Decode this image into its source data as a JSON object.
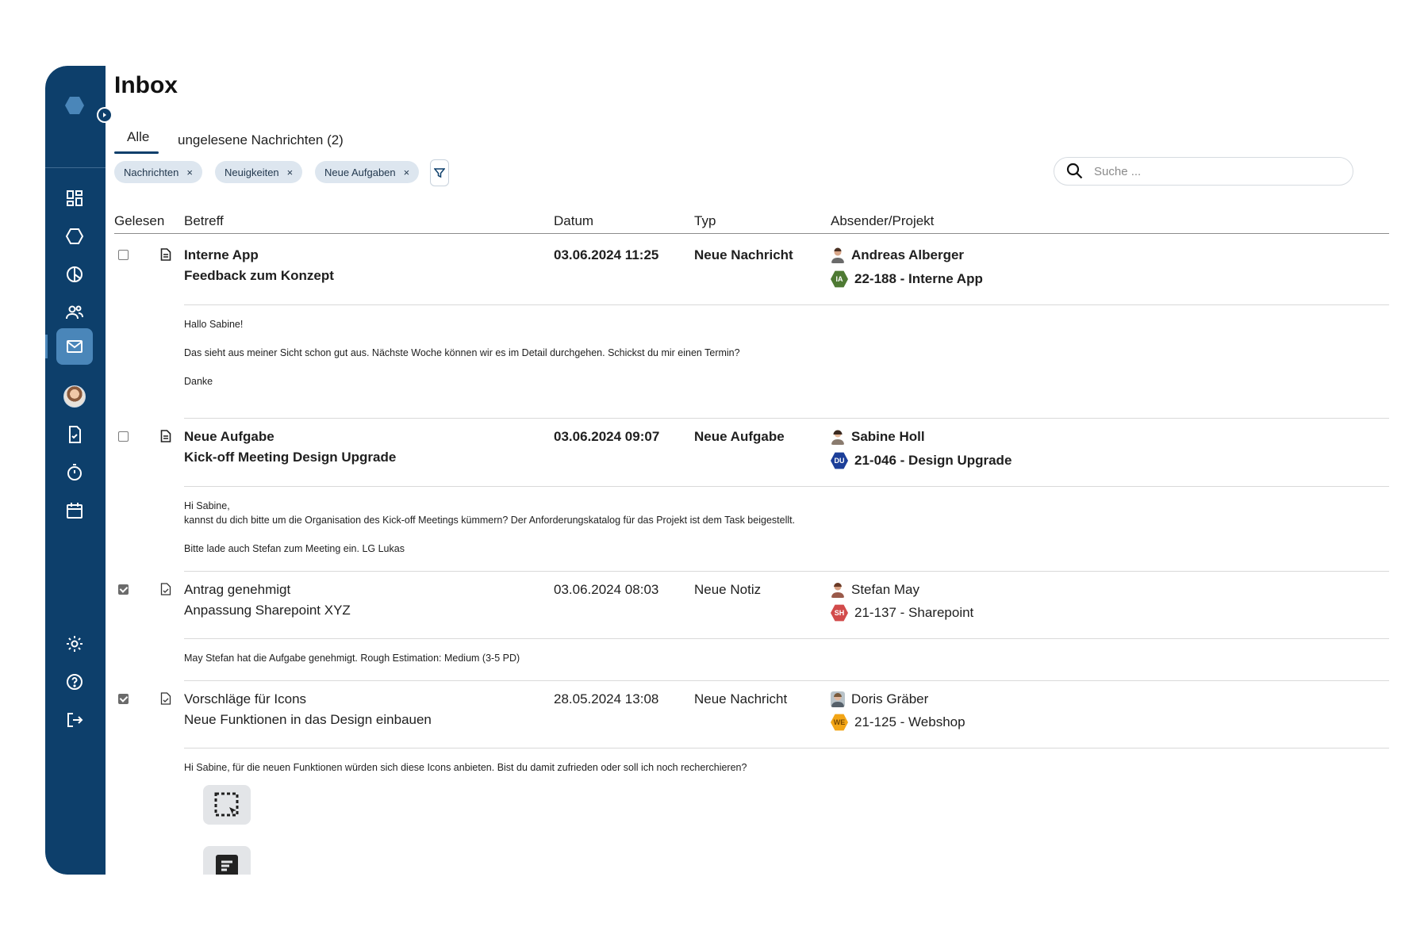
{
  "page": {
    "title": "Inbox"
  },
  "tabs": [
    {
      "label": "Alle",
      "active": true
    },
    {
      "label": "ungelesene Nachrichten (2)",
      "active": false
    }
  ],
  "filters": {
    "chips": [
      "Nachrichten",
      "Neuigkeiten",
      "Neue Aufgaben"
    ],
    "remove_glyph": "×"
  },
  "search": {
    "placeholder": "Suche ..."
  },
  "columns": [
    "Gelesen",
    "Betreff",
    "Datum",
    "Typ",
    "Absender/Projekt"
  ],
  "messages": [
    {
      "read": false,
      "title": "Interne App",
      "subtitle": "Feedback zum Konzept",
      "date": "03.06.2024 11:25",
      "type": "Neue Nachricht",
      "sender": "Andreas Alberger",
      "project": "22-188 - Interne App",
      "project_badge": "IA",
      "project_color": "#4e7a33",
      "body": [
        "Hallo Sabine!",
        "Das sieht aus meiner Sicht schon gut aus. Nächste Woche können wir es im Detail durchgehen. Schickst du mir einen Termin?",
        "Danke"
      ]
    },
    {
      "read": false,
      "title": "Neue Aufgabe",
      "subtitle": "Kick-off Meeting Design Upgrade",
      "date": "03.06.2024 09:07",
      "type": "Neue Aufgabe",
      "sender": "Sabine Holl",
      "project": "21-046 - Design Upgrade",
      "project_badge": "DU",
      "project_color": "#1c3f99",
      "body": [
        "Hi Sabine,",
        "kannst du dich bitte um die Organisation des Kick-off Meetings kümmern? Der Anforderungskatalog für das Projekt ist dem Task beigestellt.",
        "Bitte lade auch Stefan zum Meeting ein. LG Lukas"
      ]
    },
    {
      "read": true,
      "title": "Antrag genehmigt",
      "subtitle": "Anpassung Sharepoint XYZ",
      "date": "03.06.2024 08:03",
      "type": "Neue Notiz",
      "sender": "Stefan May",
      "project": "21-137 - Sharepoint",
      "project_badge": "SH",
      "project_color": "#d24b4b",
      "body": [
        "May Stefan hat die Aufgabe genehmigt. Rough Estimation: Medium (3-5 PD)"
      ]
    },
    {
      "read": true,
      "title": "Vorschläge für Icons",
      "subtitle": "Neue Funktionen in das Design einbauen",
      "date": "28.05.2024 13:08",
      "type": "Neue Nachricht",
      "sender": "Doris Gräber",
      "project": "21-125 - Webshop",
      "project_badge": "WE",
      "project_color": "#f2a516",
      "body": [
        "Hi Sabine, für die neuen Funktionen würden sich diese Icons anbieten. Bist du damit zufrieden oder soll ich noch recherchieren?"
      ],
      "attachments": [
        "selection-icon",
        "notes-icon"
      ]
    }
  ],
  "sidebar": {
    "items": [
      "dashboard-icon",
      "projects-icon",
      "reports-icon",
      "team-icon",
      "inbox-icon",
      "profile-avatar",
      "tasks-icon",
      "timer-icon",
      "calendar-icon",
      "settings-icon",
      "help-icon",
      "logout-icon"
    ],
    "active": "inbox-icon"
  },
  "colors": {
    "sidebar": "#0d3f6b",
    "active": "#4a86b9",
    "chip": "#dde6ef"
  }
}
